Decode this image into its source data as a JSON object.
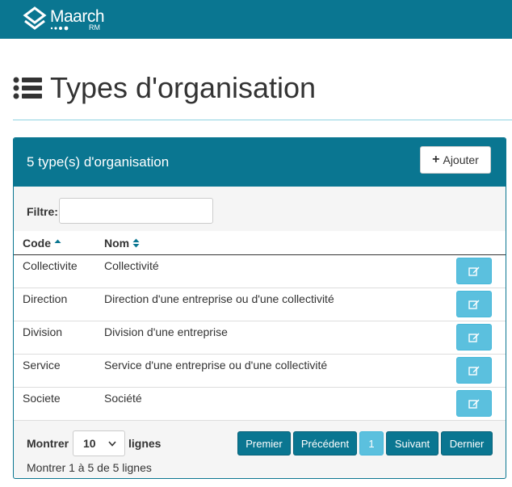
{
  "brand": {
    "name": "Maarch",
    "sub": "RM"
  },
  "page": {
    "title": "Types d'organisation"
  },
  "panel": {
    "title": "5 type(s) d'organisation",
    "add_label": "Ajouter",
    "filter_label": "Filtre:",
    "filter_value": "",
    "columns": {
      "code": "Code",
      "nom": "Nom"
    },
    "rows": [
      {
        "code": "Collectivite",
        "nom": "Collectivité"
      },
      {
        "code": "Direction",
        "nom": "Direction d'une entreprise ou d'une collectivité"
      },
      {
        "code": "Division",
        "nom": "Division d'une entreprise"
      },
      {
        "code": "Service",
        "nom": "Service d'une entreprise ou d'une collectivité"
      },
      {
        "code": "Societe",
        "nom": "Société"
      }
    ],
    "footer": {
      "show_label": "Montrer",
      "page_length": "10",
      "lines_label": "lignes",
      "info": "Montrer 1 à 5 de 5 lignes"
    },
    "pagination": {
      "first": "Premier",
      "prev": "Précédent",
      "current": "1",
      "next": "Suivant",
      "last": "Dernier"
    }
  },
  "colors": {
    "brand": "#0a7691",
    "info": "#5bc0de",
    "rule": "#8fd3e1"
  },
  "icons": [
    "maarch-logo-icon",
    "list-icon",
    "plus-icon",
    "sort-asc-icon",
    "sort-both-icon",
    "edit-icon",
    "caret-down-icon"
  ]
}
